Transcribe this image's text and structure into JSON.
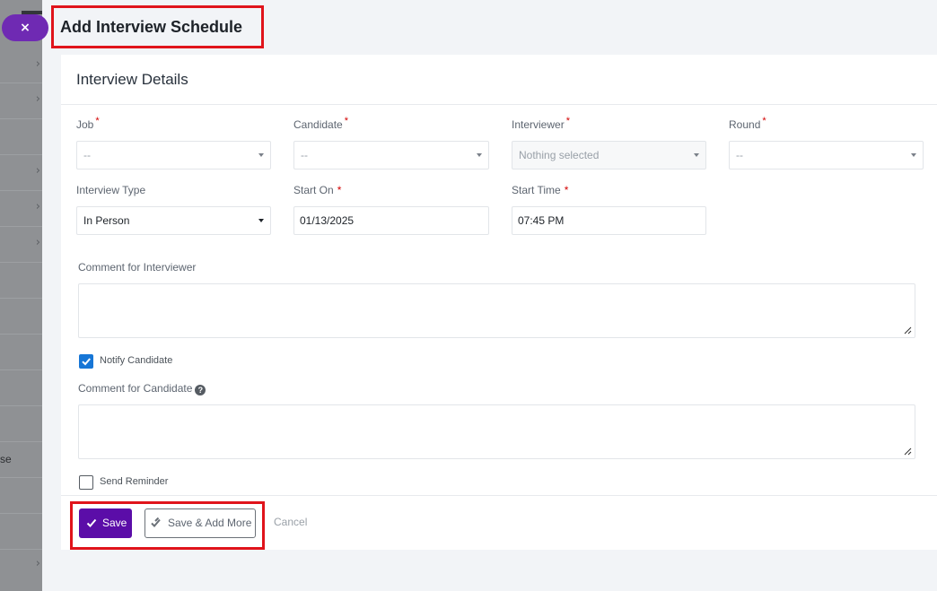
{
  "page": {
    "title": "Add Interview Schedule"
  },
  "backdrop": {
    "fragment": "se"
  },
  "close_button": {
    "label": "×"
  },
  "card": {
    "title": "Interview Details"
  },
  "fields": {
    "job": {
      "label": "Job",
      "required": "*",
      "value": "--"
    },
    "candidate": {
      "label": "Candidate",
      "required": "*",
      "value": "--"
    },
    "interviewer": {
      "label": "Interviewer",
      "required": "*",
      "value": "Nothing selected"
    },
    "round": {
      "label": "Round",
      "required": "*",
      "value": "--"
    },
    "interview_type": {
      "label": "Interview Type",
      "value": "In Person"
    },
    "start_on": {
      "label": "Start On",
      "required": "*",
      "value": "01/13/2025"
    },
    "start_time": {
      "label": "Start Time",
      "required": "*",
      "value": "07:45 PM"
    },
    "comment_interviewer": {
      "label": "Comment for Interviewer",
      "value": ""
    },
    "notify_candidate": {
      "label": "Notify Candidate",
      "checked": true
    },
    "comment_candidate": {
      "label": "Comment for Candidate",
      "help_icon": "question-circle-icon",
      "value": ""
    },
    "send_reminder": {
      "label": "Send Reminder",
      "checked": false
    }
  },
  "actions": {
    "save": "Save",
    "save_add_more": "Save & Add More",
    "cancel": "Cancel"
  },
  "colors": {
    "primary": "#5b0da8",
    "checkbox": "#1776d6",
    "highlight": "#e0141b",
    "required": "#d30000"
  }
}
